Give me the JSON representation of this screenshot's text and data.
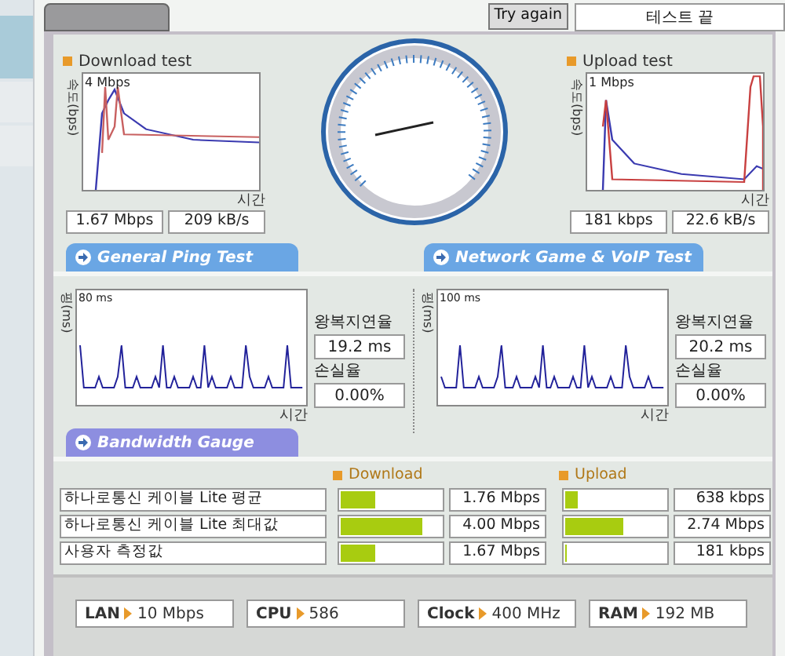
{
  "top": {
    "try_again": "Try again",
    "status": "테스트 끝"
  },
  "download": {
    "title": "Download test",
    "axis_y": "속도(bps)",
    "scale": "4 Mbps",
    "axis_x": "시간",
    "readings": [
      "1.67 Mbps",
      "209 kB/s"
    ]
  },
  "upload": {
    "title": "Upload test",
    "axis_y": "속도(bps)",
    "scale": "1 Mbps",
    "axis_x": "시간",
    "readings": [
      "181 kbps",
      "22.6 kB/s"
    ]
  },
  "sections": [
    "General Ping Test",
    "Network Game & VoIP Test"
  ],
  "ping": [
    {
      "axis_y": "핑(ms)",
      "scale": "80 ms",
      "axis_x": "시간",
      "latency_label": "왕복지연율",
      "latency": "19.2 ms",
      "loss_label": "손실율",
      "loss": "0.00%"
    },
    {
      "axis_y": "핑(ms)",
      "scale": "100 ms",
      "axis_x": "시간",
      "latency_label": "왕복지연율",
      "latency": "20.2 ms",
      "loss_label": "손실율",
      "loss": "0.00%"
    }
  ],
  "bandwidth": {
    "title": "Bandwidth Gauge",
    "download_header": "Download",
    "upload_header": "Upload",
    "rows": [
      {
        "name": "하나로통신 케이블 Lite 평균",
        "download": {
          "level": 0.35,
          "reading": "1.76 Mbps"
        },
        "upload": {
          "level": 0.12,
          "reading": "638 kbps"
        }
      },
      {
        "name": "하나로통신 케이블 Lite 최대값",
        "download": {
          "level": 0.81,
          "reading": "4.00 Mbps"
        },
        "upload": {
          "level": 0.58,
          "reading": "2.74 Mbps"
        }
      },
      {
        "name": "사용자 측정값",
        "download": {
          "level": 0.34,
          "reading": "1.67 Mbps"
        },
        "upload": {
          "level": 0.02,
          "reading": "181 kbps"
        }
      }
    ]
  },
  "system": [
    {
      "label": "LAN",
      "value": "10 Mbps"
    },
    {
      "label": "CPU",
      "value": "586"
    },
    {
      "label": "Clock",
      "value": "400 MHz"
    },
    {
      "label": "RAM",
      "value": "192 MB"
    }
  ]
}
